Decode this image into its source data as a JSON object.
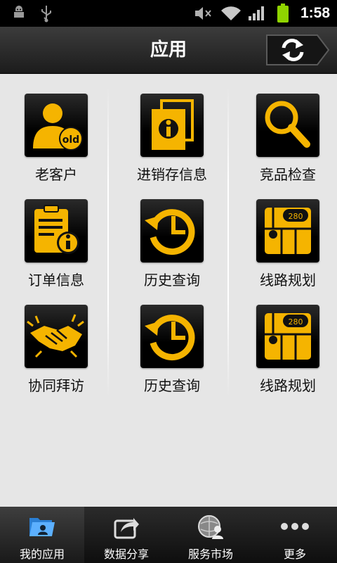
{
  "status_bar": {
    "time": "1:58",
    "icons": [
      "android-debug-icon",
      "usb-icon",
      "mute-icon",
      "wifi-icon",
      "signal-icon",
      "battery-icon"
    ]
  },
  "header": {
    "title": "应用",
    "refresh_icon": "refresh-icon"
  },
  "apps": [
    {
      "label": "老客户",
      "icon": "old-customer-icon"
    },
    {
      "label": "进销存信息",
      "icon": "inventory-info-icon"
    },
    {
      "label": "竞品检查",
      "icon": "search-icon"
    },
    {
      "label": "订单信息",
      "icon": "order-info-icon"
    },
    {
      "label": "历史查询",
      "icon": "history-icon"
    },
    {
      "label": "线路规划",
      "icon": "route-map-icon"
    },
    {
      "label": "协同拜访",
      "icon": "handshake-icon"
    },
    {
      "label": "历史查询",
      "icon": "history-icon"
    },
    {
      "label": "线路规划",
      "icon": "route-map-icon"
    }
  ],
  "bottom_tabs": [
    {
      "label": "我的应用",
      "icon": "my-apps-folder-icon",
      "active": true
    },
    {
      "label": "数据分享",
      "icon": "share-icon",
      "active": false
    },
    {
      "label": "服务市场",
      "icon": "service-market-icon",
      "active": false
    },
    {
      "label": "更多",
      "icon": "more-icon",
      "active": false
    }
  ],
  "colors": {
    "accent": "#f5b400",
    "header_bg": "#2a2a2a",
    "content_bg": "#e6e6e6",
    "tabbar_bg": "#1c1c1c"
  }
}
